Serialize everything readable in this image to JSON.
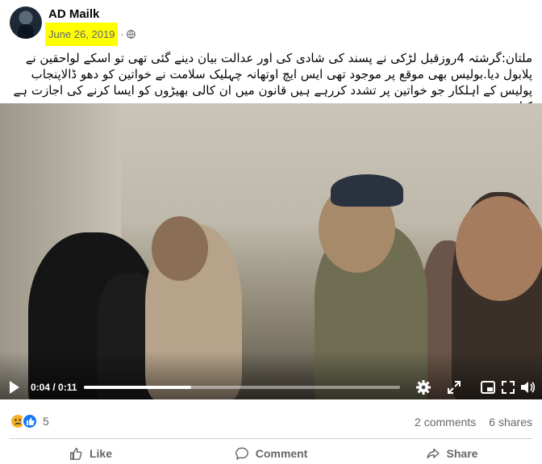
{
  "post": {
    "author": "AD Mailk",
    "date": "June 26, 2019",
    "separator": "·",
    "text": "ملتان:گرشتہ 4روزقبل لڑکی نے پسند کی شادی کی اور عدالت بیان دینے گئی تھی تو اسکے لواحقین نے پلابول دیا.بولیس بھی موقع پر موجود تھی ایس ایچ اوتھانہ چہلیک سلامت نے خواتین کو دھو ڈالاپنجاب پولیس کے اہلکار جو خواتین پر تشدد کررہے ہیں قانون میں ان کالی بھیڑوں کو ایسا کرنے کی اجازت ہے کیا"
  },
  "video": {
    "time": "0:04 / 0:11",
    "progress": 0.34
  },
  "stats": {
    "reaction_count": "5",
    "comments": "2 comments",
    "shares": "6 shares"
  },
  "actions": {
    "like": "Like",
    "comment": "Comment",
    "share": "Share"
  },
  "colors": {
    "accent": "#1877f2",
    "date_highlight": "#ffff00",
    "muted": "#65676b"
  },
  "icons": [
    "globe-icon",
    "play-icon",
    "settings-icon",
    "fullscreen-expand-icon",
    "picture-in-picture-icon",
    "fullscreen-icon",
    "volume-icon",
    "sad-reaction-icon",
    "like-reaction-icon",
    "like-icon",
    "comment-icon",
    "share-icon"
  ]
}
